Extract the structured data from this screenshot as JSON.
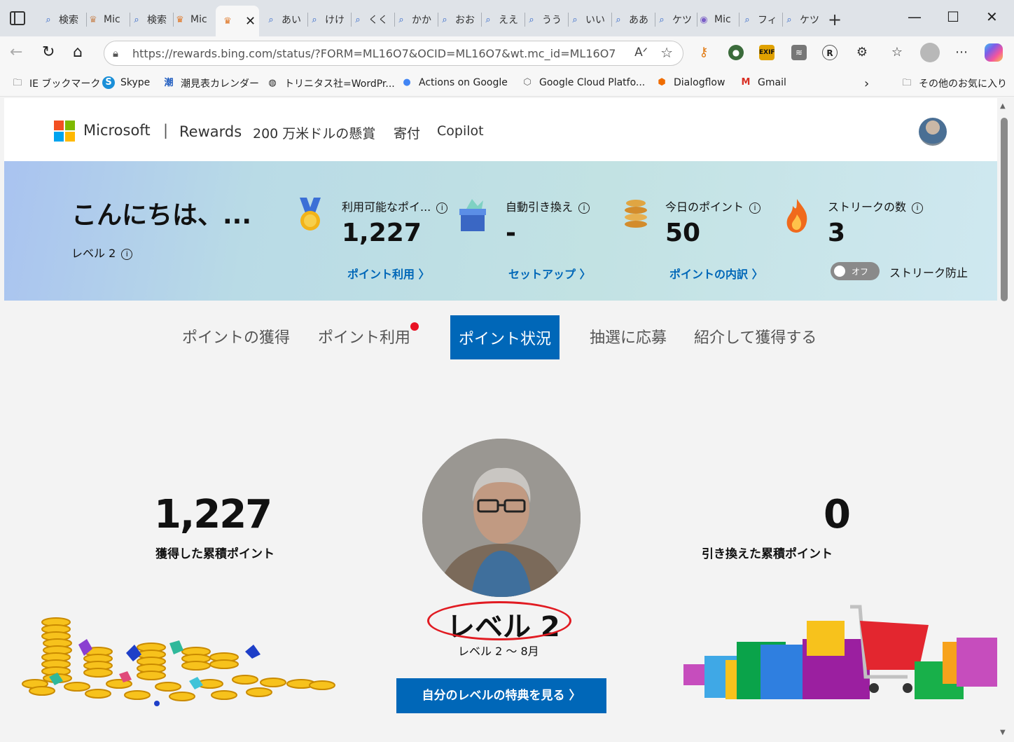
{
  "browser": {
    "tabs": [
      {
        "label": "検索",
        "icon": "search-icon"
      },
      {
        "label": "Mic",
        "icon": "rewards-icon"
      },
      {
        "label": "検索",
        "icon": "search-icon"
      },
      {
        "label": "Mic",
        "icon": "rewards-icon"
      },
      {
        "label": "",
        "icon": "rewards-icon",
        "active": true
      },
      {
        "label": "あい",
        "icon": "search-icon"
      },
      {
        "label": "けけ",
        "icon": "search-icon"
      },
      {
        "label": "くく",
        "icon": "search-icon"
      },
      {
        "label": "かか",
        "icon": "search-icon"
      },
      {
        "label": "おお",
        "icon": "search-icon"
      },
      {
        "label": "ええ",
        "icon": "search-icon"
      },
      {
        "label": "うう",
        "icon": "search-icon"
      },
      {
        "label": "いい",
        "icon": "search-icon"
      },
      {
        "label": "ああ",
        "icon": "search-icon"
      },
      {
        "label": "ケツ",
        "icon": "search-icon"
      },
      {
        "label": "Mic",
        "icon": "viber-icon"
      },
      {
        "label": "フィ",
        "icon": "search-icon"
      },
      {
        "label": "ケツ",
        "icon": "search-icon"
      }
    ],
    "url": "https://rewards.bing.com/status/?FORM=ML16O7&OCID=ML16O7&wt.mc_id=ML16O7",
    "bookmarks": [
      {
        "label": "IE ブックマーク",
        "icon": "folder-icon"
      },
      {
        "label": "Skype",
        "icon": "skype-icon"
      },
      {
        "label": "潮見表カレンダー",
        "icon": "tide-icon"
      },
      {
        "label": "トリニタス社=WordPr...",
        "icon": "globe-icon"
      },
      {
        "label": "Actions on Google",
        "icon": "google-assistant-icon"
      },
      {
        "label": "Google Cloud Platfo...",
        "icon": "gcp-icon"
      },
      {
        "label": "Dialogflow",
        "icon": "dialogflow-icon"
      },
      {
        "label": "Gmail",
        "icon": "gmail-icon"
      }
    ],
    "other_favorites": "その他のお気に入り"
  },
  "header": {
    "brand": "Microsoft",
    "divider": "|",
    "product": "Rewards",
    "nav": [
      "200 万米ドルの懸賞",
      "寄付",
      "Copilot"
    ]
  },
  "banner": {
    "greeting": "こんにちは、...",
    "level": "レベル 2",
    "stats": [
      {
        "label": "利用可能なポイ...",
        "value": "1,227",
        "link": "ポイント利用 〉",
        "icon": "medal-icon"
      },
      {
        "label": "自動引き換え",
        "value": "-",
        "link": "セットアップ 〉",
        "icon": "gift-icon"
      },
      {
        "label": "今日のポイント",
        "value": "50",
        "link": "ポイントの内訳 〉",
        "icon": "coin-stack-icon"
      },
      {
        "label": "ストリークの数",
        "value": "3",
        "icon": "flame-icon"
      }
    ],
    "toggle_text": "オフ",
    "toggle_label": "ストリーク防止"
  },
  "tabs": [
    "ポイントの獲得",
    "ポイント利用",
    "ポイント状況",
    "抽選に応募",
    "紹介して獲得する"
  ],
  "active_tab": "ポイント状況",
  "status": {
    "earned_value": "1,227",
    "earned_label": "獲得した累積ポイント",
    "redeemed_value": "0",
    "redeemed_label": "引き換えた累積ポイント",
    "level_title": "レベル 2",
    "level_sub": "レベル 2 〜 8月",
    "benefits_button": "自分のレベルの特典を見る 〉"
  },
  "colors": {
    "accent": "#0067b8",
    "annotation": "#e11b22",
    "notification_dot": "#e81123"
  }
}
